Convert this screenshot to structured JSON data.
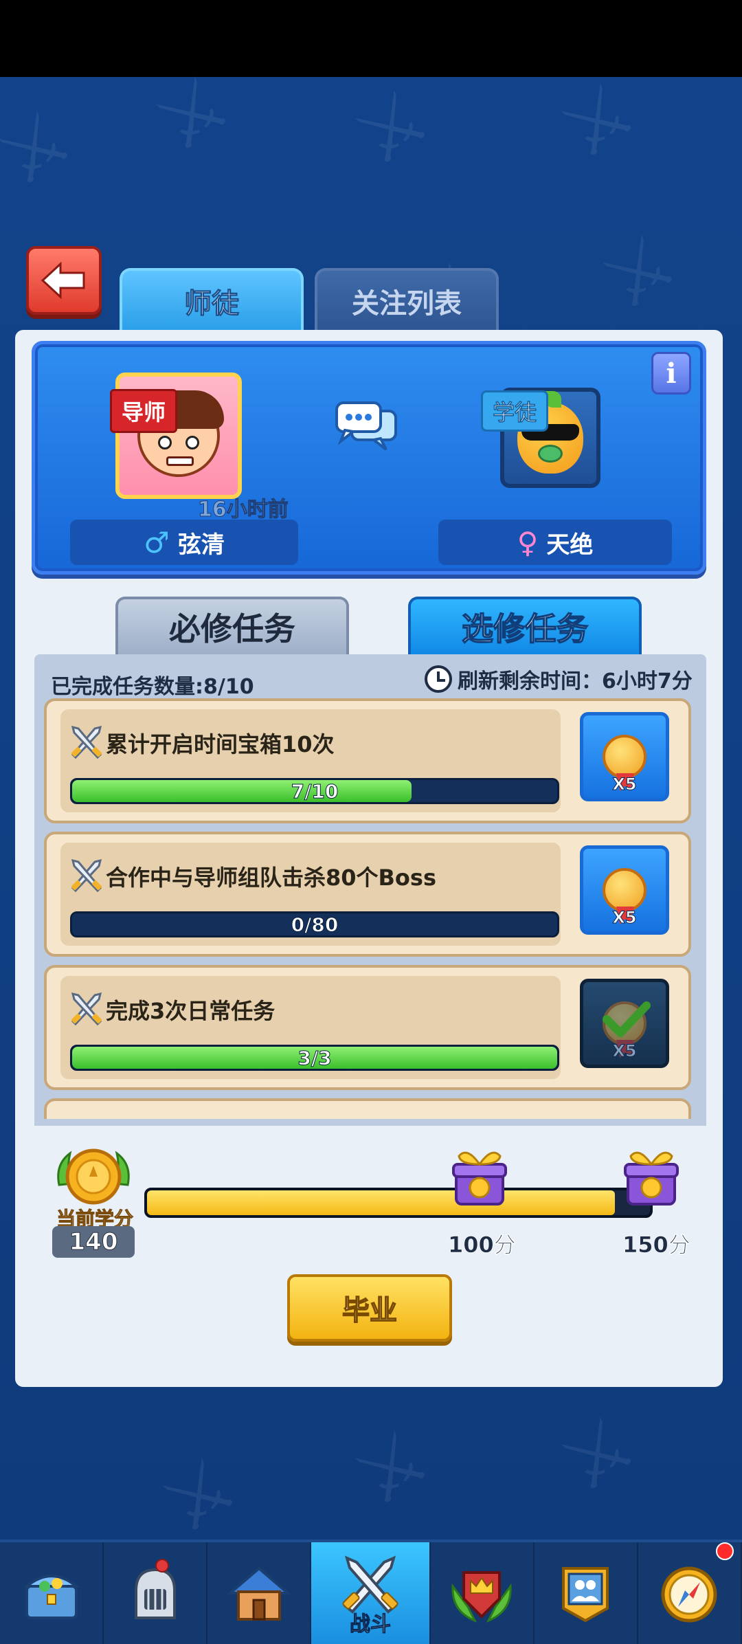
{
  "header": {
    "tabs": [
      {
        "label": "师徒",
        "active": true
      },
      {
        "label": "关注列表",
        "active": false
      }
    ]
  },
  "mentor_card": {
    "mentor_tag": "导师",
    "mentor_last_seen": "16小时前",
    "mentor_name": "弦清",
    "mentor_gender_icon": "♂",
    "student_tag": "学徒",
    "student_name": "天绝",
    "student_gender_icon": "♀",
    "info_icon": "i"
  },
  "task_tabs": [
    {
      "label": "必修任务",
      "active": false
    },
    {
      "label": "选修任务",
      "active": true
    }
  ],
  "task_summary": {
    "completed": "已完成任务数量:8/10",
    "refresh": "刷新剩余时间：6小时7分"
  },
  "tasks": [
    {
      "title": "累计开启时间宝箱10次",
      "progress": "7/10",
      "fraction": 0.7,
      "reward": "X5",
      "claimed": false
    },
    {
      "title": "合作中与导师组队击杀80个Boss",
      "progress": "0/80",
      "fraction": 0.0,
      "reward": "X5",
      "claimed": false
    },
    {
      "title": "完成3次日常任务",
      "progress": "3/3",
      "fraction": 1.0,
      "reward": "X5",
      "claimed": true
    }
  ],
  "score": {
    "label": "当前学分",
    "value": "140",
    "fill_fraction": 0.93,
    "milestones": [
      "100分",
      "150分"
    ]
  },
  "graduate_button": "毕业",
  "bottom_nav": [
    {
      "icon": "treasure-chest-icon",
      "label": ""
    },
    {
      "icon": "knight-helmet-icon",
      "label": ""
    },
    {
      "icon": "house-icon",
      "label": ""
    },
    {
      "icon": "crossed-swords-icon",
      "label": "战斗",
      "active": true
    },
    {
      "icon": "crown-shield-icon",
      "label": ""
    },
    {
      "icon": "guild-banner-icon",
      "label": ""
    },
    {
      "icon": "compass-icon",
      "label": "",
      "badge": true
    }
  ],
  "colors": {
    "background": "#0f3a78",
    "accent_blue": "#2a9fe8",
    "progress_green": "#3bbf2c",
    "score_yellow": "#f4b915",
    "back_red": "#e03b2d"
  }
}
